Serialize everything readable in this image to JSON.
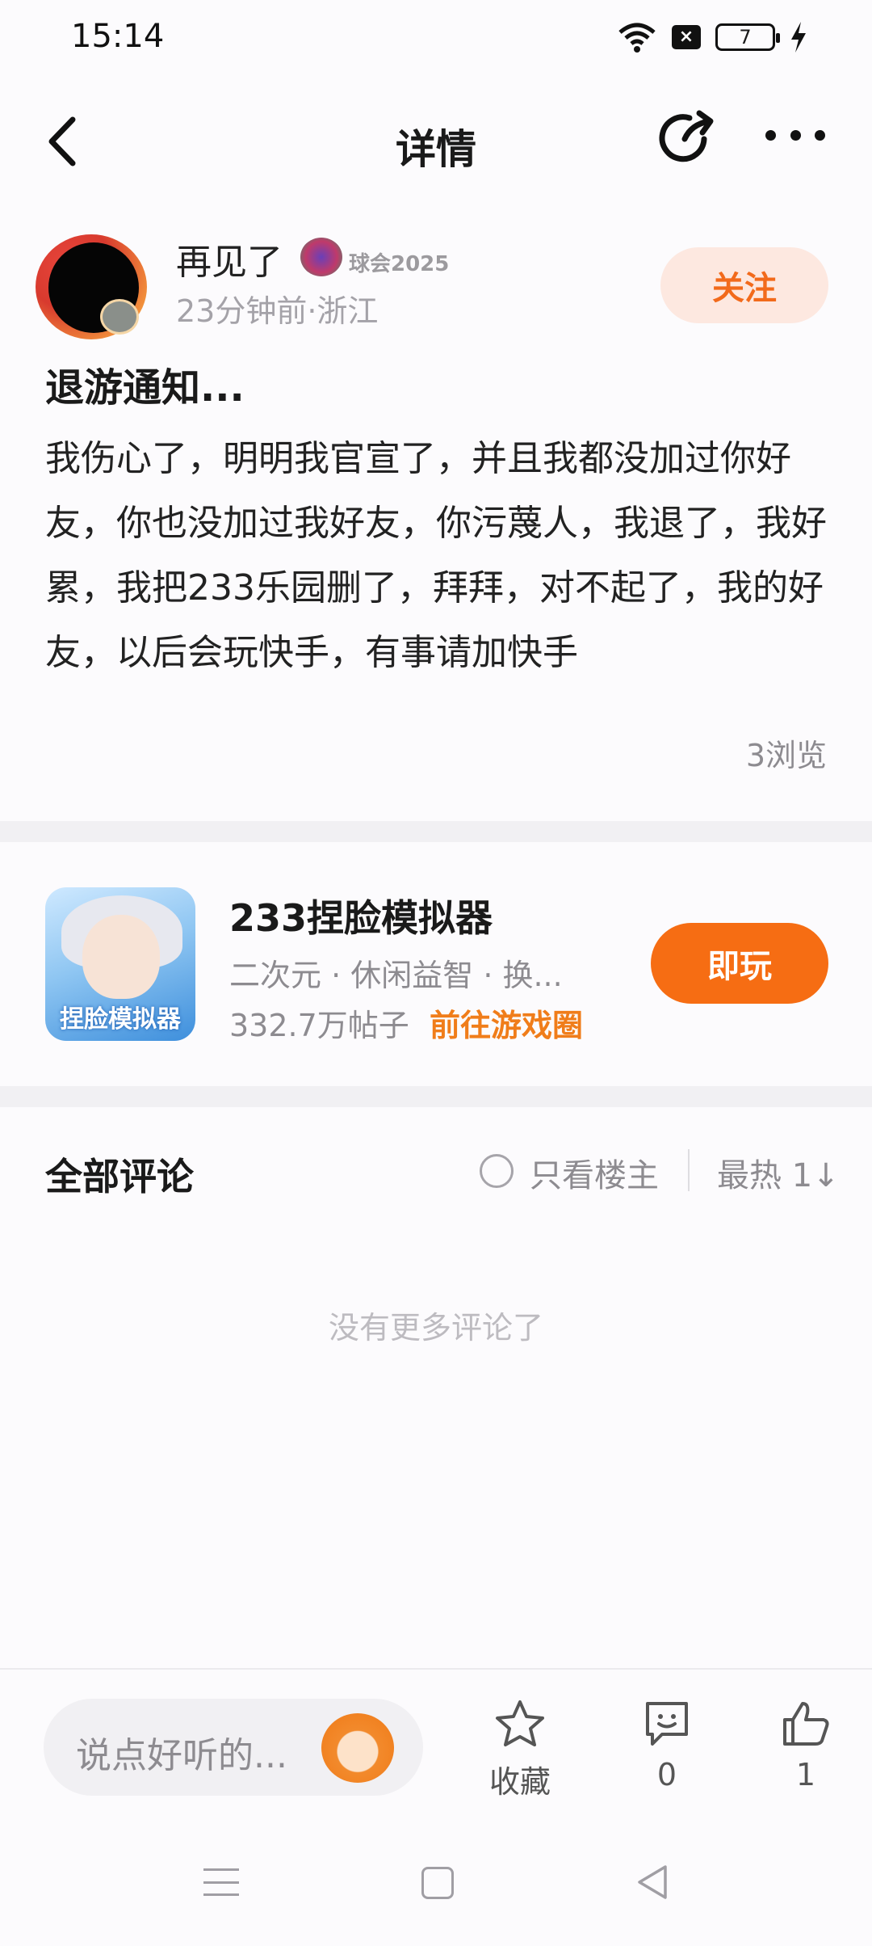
{
  "status_bar": {
    "time": "15:14",
    "battery": "7"
  },
  "header": {
    "title": "详情"
  },
  "author": {
    "name": "再见了",
    "badge": "球会2025",
    "meta": "23分钟前·浙江",
    "follow_label": "关注"
  },
  "post": {
    "title": "退游通知...",
    "body": "我伤心了，明明我官宣了，并且我都没加过你好友，你也没加过我好友，你污蔑人，我退了，我好累，我把233乐园删了，拜拜，对不起了，我的好友，以后会玩快手，有事请加快手",
    "views": "3浏览"
  },
  "game": {
    "icon_label": "捏脸模拟器",
    "name": "233捏脸模拟器",
    "tags": "二次元 · 休闲益智 · 换...",
    "posts": "332.7万帖子",
    "link": "前往游戏圈",
    "play_label": "即玩"
  },
  "comments": {
    "title": "全部评论",
    "owner_only": "只看楼主",
    "sort": "最热 1↓",
    "empty": "没有更多评论了"
  },
  "bottom_bar": {
    "placeholder": "说点好听的...",
    "favorite_label": "收藏",
    "comment_count": "0",
    "like_count": "1"
  },
  "colors": {
    "accent": "#f66d13",
    "follow_bg": "#fde8e0",
    "link": "#f07d1a"
  }
}
